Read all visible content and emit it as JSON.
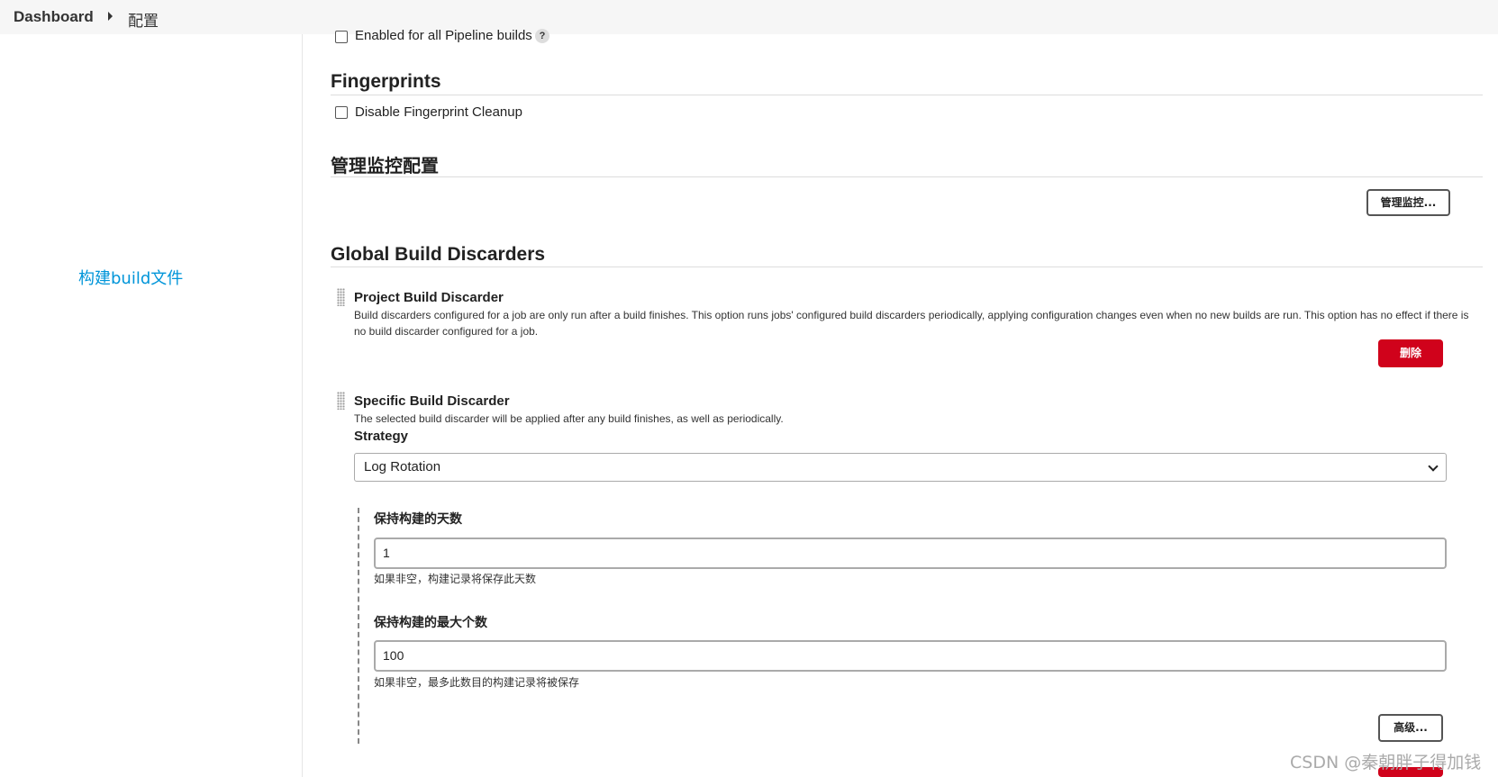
{
  "breadcrumb": {
    "home": "Dashboard",
    "current": "配置"
  },
  "annotation": "构建build文件",
  "pipeline": {
    "label": "Enabled for all Pipeline builds",
    "help": "?"
  },
  "fingerprints": {
    "title": "Fingerprints",
    "cleanup_label": "Disable Fingerprint Cleanup"
  },
  "monitor": {
    "title": "管理监控配置",
    "button": "管理监控..."
  },
  "discarders": {
    "title": "Global Build Discarders",
    "project": {
      "title": "Project Build Discarder",
      "description": "Build discarders configured for a job are only run after a build finishes. This option runs jobs' configured build discarders periodically, applying configuration changes even when no new builds are run. This option has no effect if there is no build discarder configured for a job.",
      "delete": "删除"
    },
    "specific": {
      "title": "Specific Build Discarder",
      "description": "The selected build discarder will be applied after any build finishes, as well as periodically.",
      "strategy_label": "Strategy",
      "strategy_value": "Log Rotation",
      "days_label": "保持构建的天数",
      "days_value": "1",
      "days_hint": "如果非空，构建记录将保存此天数",
      "max_label": "保持构建的最大个数",
      "max_value": "100",
      "max_hint": "如果非空，最多此数目的构建记录将被保存",
      "advanced": "高级..."
    }
  },
  "watermark": "CSDN @秦朝胖子得加钱"
}
